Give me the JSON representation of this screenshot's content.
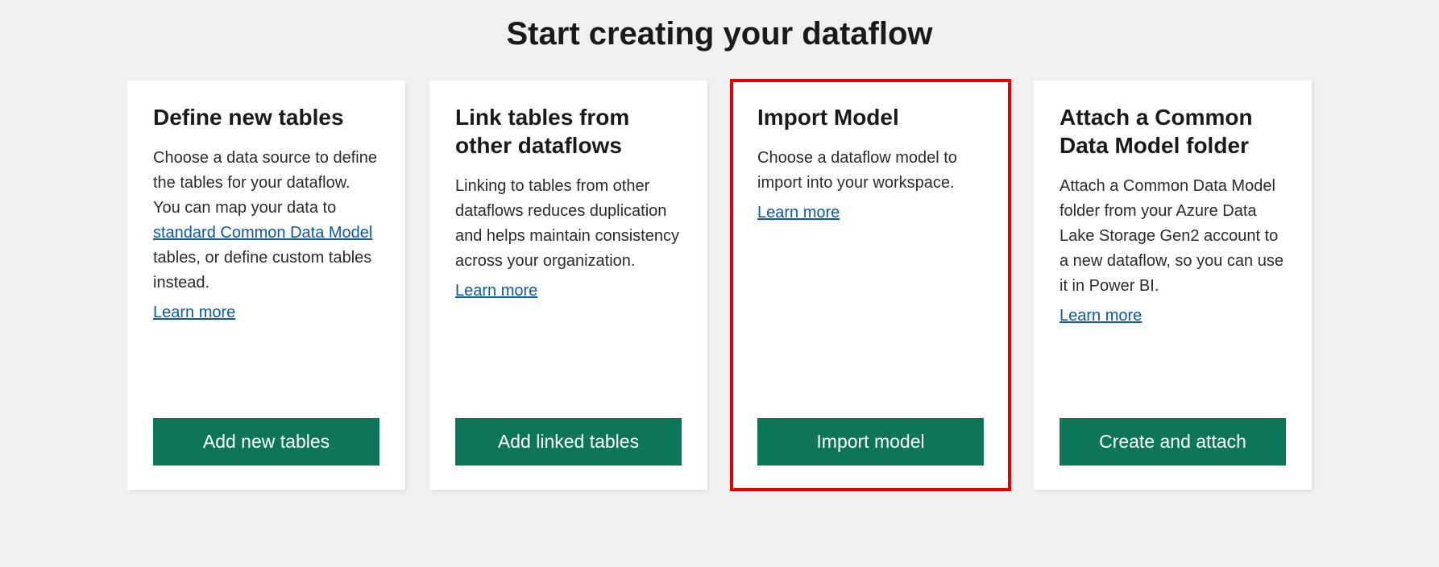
{
  "page_title": "Start creating your dataflow",
  "learn_more_label": "Learn more",
  "cards": [
    {
      "title": "Define new tables",
      "description_pre": "Choose a data source to define the tables for your dataflow. You can map your data to ",
      "description_link": "standard Common Data Model",
      "description_post": " tables, or define custom tables instead.",
      "button_label": "Add new tables",
      "highlighted": false
    },
    {
      "title": "Link tables from other dataflows",
      "description_pre": "Linking to tables from other dataflows reduces duplication and helps maintain consistency across your organization.",
      "description_link": "",
      "description_post": "",
      "button_label": "Add linked tables",
      "highlighted": false
    },
    {
      "title": "Import Model",
      "description_pre": "Choose a dataflow model to import into your workspace.",
      "description_link": "",
      "description_post": "",
      "button_label": "Import model",
      "highlighted": true
    },
    {
      "title": "Attach a Common Data Model folder",
      "description_pre": "Attach a Common Data Model folder from your Azure Data Lake Storage Gen2 account to a new dataflow, so you can use it in Power BI.",
      "description_link": "",
      "description_post": "",
      "button_label": "Create and attach",
      "highlighted": false
    }
  ]
}
